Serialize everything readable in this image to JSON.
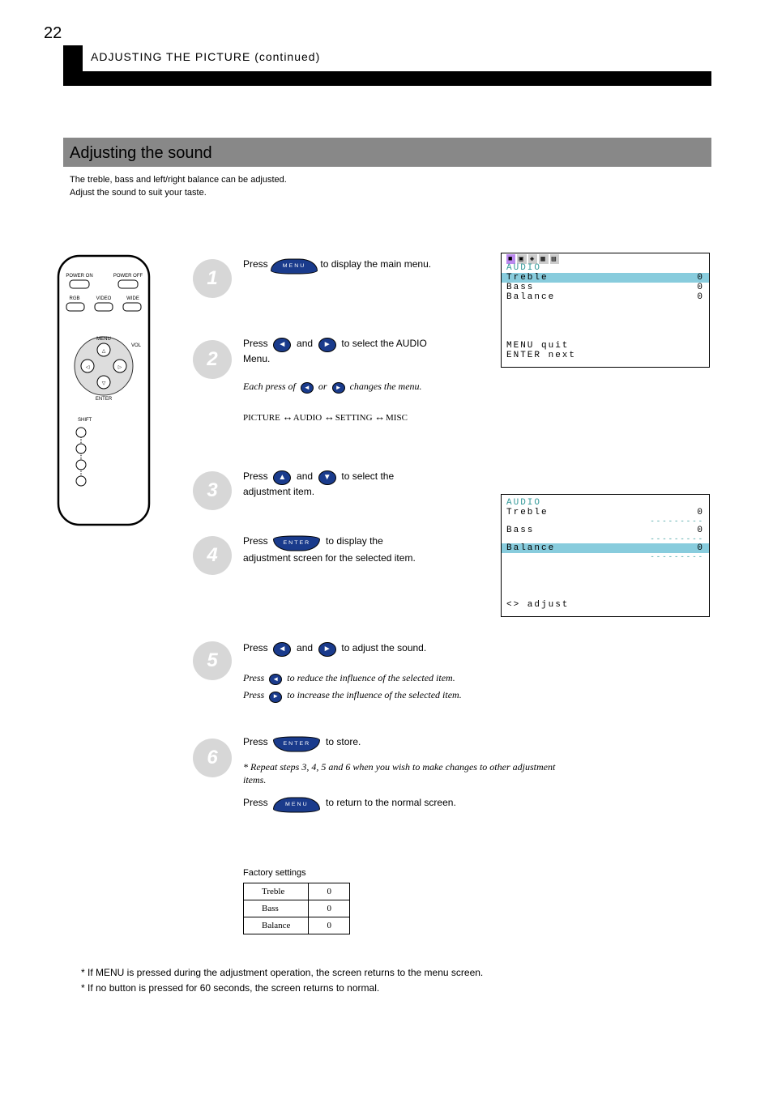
{
  "heading_line": "ADJUSTING THE PICTURE (continued)",
  "page_number": "22",
  "gray_band": "Adjusting the sound",
  "subtitle_line1": "The treble, bass and left/right balance can be adjusted.",
  "subtitle_line2": "Adjust the sound to suit your taste.",
  "remote": {
    "power_on": "POWER ON",
    "power_off": "POWER OFF",
    "rgb": "RGB",
    "video": "VIDEO",
    "wide": "WIDE",
    "menu": "MENU",
    "vol": "VOL",
    "enter": "ENTER",
    "shift": "SHIFT"
  },
  "buttons": {
    "menu": "MENU",
    "enter": "ENTER",
    "left": "◄",
    "right": "►",
    "up": "▲",
    "down": "▼"
  },
  "steps": {
    "s1": {
      "n": "1",
      "text": "Press             to display the main menu."
    },
    "s2": {
      "n": "2",
      "line1": "Press       and       to select the AUDIO",
      "line2": "Menu.",
      "note1": "Each press of       or       changes the menu.",
      "mrow_a": "PICTURE",
      "mrow_b": "AUDIO",
      "mrow_c": "SETTING",
      "mrow_d": "MISC"
    },
    "s3": {
      "n": "3",
      "line1": "Press       and       to select the",
      "line2": "adjustment item."
    },
    "s4": {
      "n": "4",
      "text": "Press             to display the",
      "text2": "adjustment screen for the selected item."
    },
    "s5": {
      "n": "5",
      "line1": "Press       and       to adjust the sound.",
      "hint1a": "Press        to reduce the influence of the selected item.",
      "hint1b": "Press        to increase the influence of the selected item."
    },
    "s6": {
      "n": "6",
      "line1": "Press             to store.",
      "note": "* Repeat steps 3, 4, 5 and 6 when you wish to make changes to other adjustment items.",
      "line2": "Press             to return to the normal screen."
    }
  },
  "osd1": {
    "title": "AUDIO",
    "rows": [
      {
        "label": "Treble",
        "val": "0"
      },
      {
        "label": "Bass",
        "val": "0"
      },
      {
        "label": "Balance",
        "val": "0"
      }
    ],
    "hint1": "MENU  quit",
    "hint2": "ENTER next"
  },
  "osd2": {
    "title": "AUDIO",
    "rows": [
      {
        "label": "Treble",
        "val": "0"
      },
      {
        "label": "Bass",
        "val": "0"
      },
      {
        "label": "Balance",
        "val": "0"
      }
    ],
    "bars": "---------",
    "hint": "<> adjust"
  },
  "factory": {
    "label": "Factory settings",
    "rows": [
      {
        "a": "Treble",
        "b": "0"
      },
      {
        "a": "Bass",
        "b": "0"
      },
      {
        "a": "Balance",
        "b": "0"
      }
    ]
  },
  "foot": {
    "line1": "* If MENU is pressed during the adjustment operation, the screen returns to the menu screen.",
    "line2": "* If no button is pressed for 60 seconds, the screen returns to normal."
  },
  "arrow_glyph": "↔"
}
